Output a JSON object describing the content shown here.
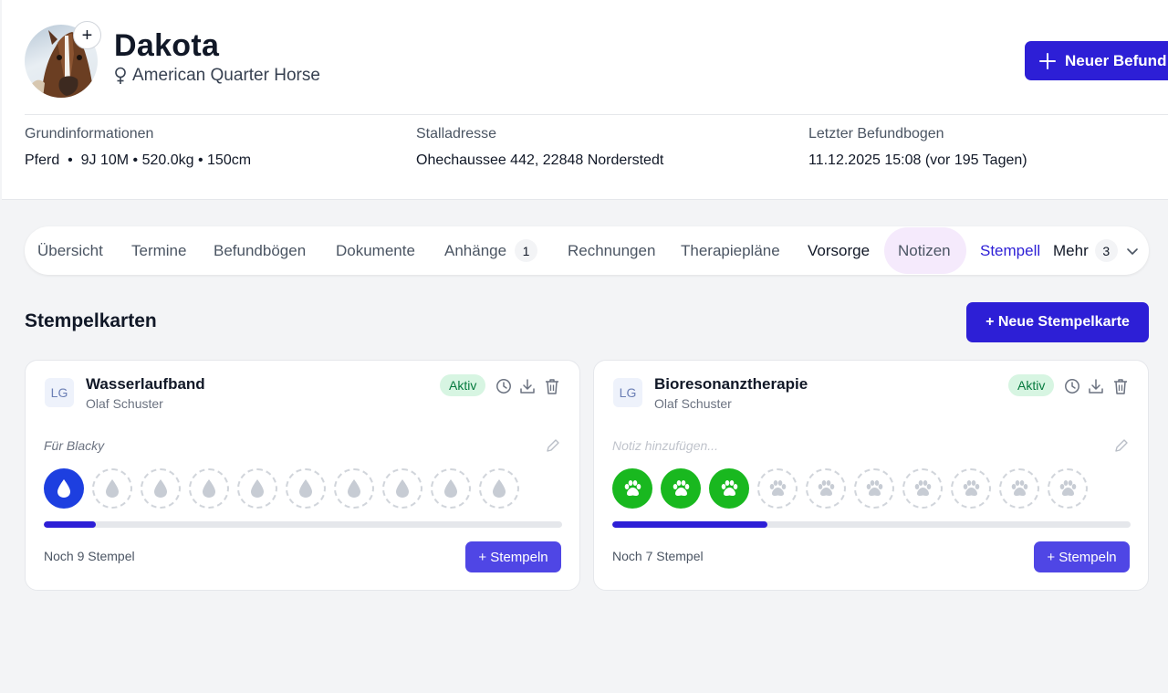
{
  "pet": {
    "name": "Dakota",
    "breed": "American Quarter Horse",
    "add_photo_symbol": "+"
  },
  "header": {
    "new_report_label": "Neuer Befund"
  },
  "info": {
    "basic_label": "Grundinformationen",
    "basic_value": "Pferd  •  9J 10M • 520.0kg • 150cm",
    "stable_label": "Stalladresse",
    "stable_value": "Ohechaussee 442, 22848 Norderstedt",
    "last_report_label": "Letzter Befundbogen",
    "last_report_value": "11.12.2025 15:08 (vor 195 Tagen)"
  },
  "tabs": {
    "overview": "Übersicht",
    "appointments": "Termine",
    "reports": "Befundbögen",
    "documents": "Dokumente",
    "attachments": "Anhänge",
    "attachments_count": "1",
    "invoices": "Rechnungen",
    "therapy_plans": "Therapiepläne",
    "prevention": "Vorsorge",
    "notes": "Notizen",
    "stamp": "Stempell",
    "more": "Mehr",
    "more_count": "3"
  },
  "section": {
    "title": "Stempelkarten",
    "new_card_label": "+ Neue Stempelkarte"
  },
  "cards": [
    {
      "initials": "LG",
      "title": "Wasserlaufband",
      "owner": "Olaf Schuster",
      "status": "Aktiv",
      "note": "Für Blacky",
      "filled": 1,
      "total": 10,
      "stamp_icon": "water-drop-icon",
      "stamp_color": "#1d3fe0",
      "progress": 0.1,
      "remaining": "Noch 9 Stempel",
      "stamp_button": "+ Stempeln"
    },
    {
      "initials": "LG",
      "title": "Bioresonanztherapie",
      "owner": "Olaf Schuster",
      "status": "Aktiv",
      "note": "Notiz hinzufügen...",
      "filled": 3,
      "total": 10,
      "stamp_icon": "paw-icon",
      "stamp_color": "#19b81f",
      "progress": 0.3,
      "remaining": "Noch 7 Stempel",
      "stamp_button": "+ Stempeln"
    }
  ],
  "colors": {
    "primary": "#2d1fd6",
    "active_badge_bg": "#d7f5e2",
    "active_badge_text": "#067a3e",
    "notes_tab_highlight": "#f5eafc"
  }
}
